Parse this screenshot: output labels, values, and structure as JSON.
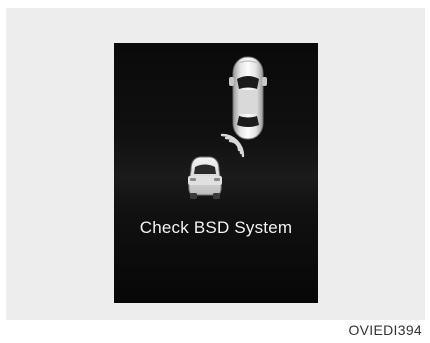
{
  "display": {
    "message": "Check BSD System"
  },
  "image_code": "OVIEDI394",
  "icons": {
    "host_car": "car-top-view-icon",
    "rear_car": "car-rear-view-icon",
    "sensor_waves": "radar-waves-icon"
  },
  "colors": {
    "screen_background": "#060606",
    "text": "#f2f2f2",
    "frame_background": "#ededed"
  }
}
